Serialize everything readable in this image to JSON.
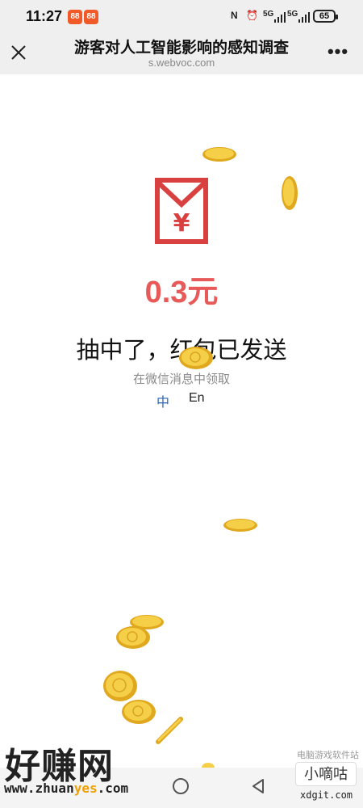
{
  "status_bar": {
    "time": "11:27",
    "app_badge_1": "88",
    "app_badge_2": "88",
    "nfc_icon": "N",
    "alarm_icon": "⏰",
    "signal_1": "5G",
    "signal_2": "5G",
    "battery": "65"
  },
  "nav": {
    "title": "游客对人工智能影响的感知调查",
    "url": "s.webvoc.com",
    "more_label": "•••",
    "close_icon": "close-icon"
  },
  "result": {
    "envelope_icon": "red-envelope-icon",
    "currency_symbol": "¥",
    "amount": "0.3元",
    "message": "抽中了，红包已发送",
    "sub_message": "在微信消息中领取",
    "lang_zh": "中",
    "lang_en": "En"
  },
  "colors": {
    "accent_red": "#e85a5a",
    "envelope_red": "#d94141",
    "lang_active": "#2a62b8",
    "coin_gold": "#f2c12e"
  },
  "watermarks": {
    "left_big": "好赚网",
    "left_small_pre": "www.zhuan",
    "left_small_hl": "yes",
    "left_small_post": ".com",
    "right_top": "电脑游戏软件站",
    "right_box": "小嘀咕",
    "right_bottom": "xdgit.com"
  }
}
